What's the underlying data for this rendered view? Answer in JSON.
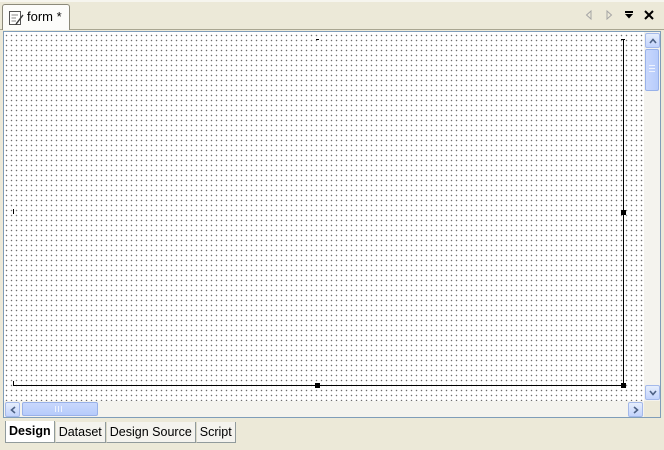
{
  "editor_tab": {
    "label": "form *",
    "icon": "form-editor-icon"
  },
  "tab_controls": {
    "prev_icon": "triangle-left-icon",
    "next_icon": "triangle-right-icon",
    "menu_icon": "chevron-down-icon",
    "close_icon": "close-icon"
  },
  "bottom_tabs": [
    {
      "label": "Design",
      "active": true
    },
    {
      "label": "Dataset",
      "active": false
    },
    {
      "label": "Design Source",
      "active": false
    },
    {
      "label": "Script",
      "active": false
    }
  ],
  "colors": {
    "chrome": "#ece9d8",
    "scroll_accent": "#c2d3fc",
    "canvas": "#ffffff",
    "grid_dot": "#6e6e6e"
  }
}
